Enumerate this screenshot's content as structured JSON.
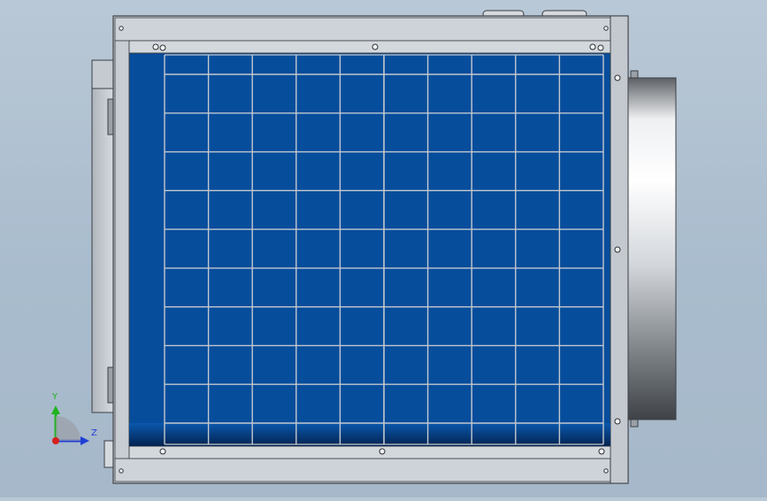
{
  "viewport": {
    "background_top": "#b9c8d6",
    "background_bottom": "#a6b8c9"
  },
  "model": {
    "frame_color": "#c9cfd5",
    "frame_edge_color": "#3c3f44",
    "panel_color": "#064d9c",
    "panel_dark_color": "#032f66",
    "grille_color": "#c3c8ce",
    "grille_rows": 9,
    "grille_cols": 10,
    "outlet_color": "#d9dde2",
    "outlet_shadow_color": "#4e5257"
  },
  "triad": {
    "y_label": "Y",
    "z_label": "Z",
    "y_axis_color": "#1fb31f",
    "z_axis_color": "#1f3fd6",
    "x_axis_color": "#d81f1f"
  }
}
